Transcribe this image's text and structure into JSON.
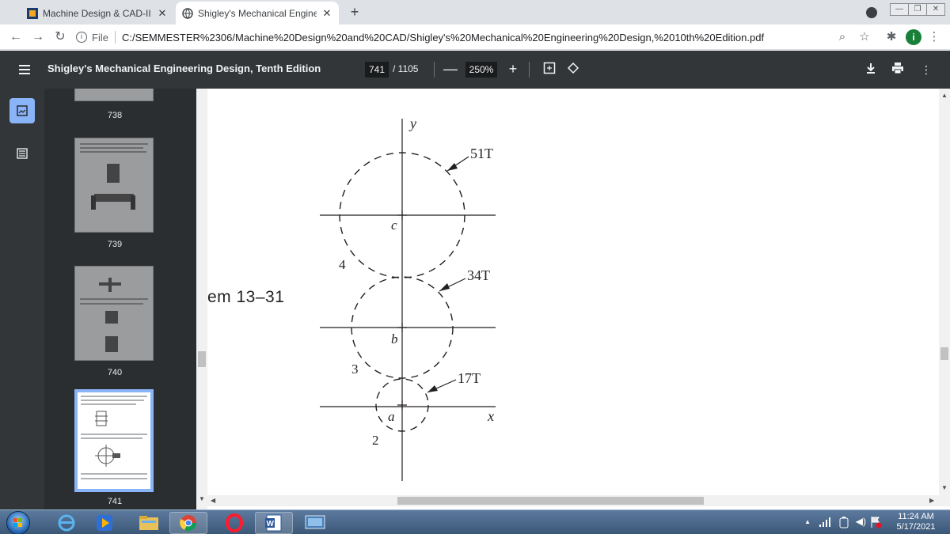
{
  "tabs": [
    {
      "title": "Machine Design & CAD-II (Engr.M",
      "close": "✕",
      "active": false
    },
    {
      "title": "Shigley's Mechanical Engineering",
      "close": "✕",
      "active": true
    }
  ],
  "new_tab": "+",
  "addressbar": {
    "scheme_label": "File",
    "url": "C:/SEMMESTER%2306/Machine%20Design%20and%20CAD/Shigley's%20Mechanical%20Engineering%20Design,%2010th%20Edition.pdf"
  },
  "profile_initial": "i",
  "pdf_toolbar": {
    "title": "Shigley's Mechanical Engineering Design, Tenth Edition",
    "current_page": "741",
    "total_pages": "/ 1105",
    "zoom": "250%",
    "zoom_out": "—",
    "zoom_in": "+"
  },
  "sidebar": {
    "thumbnails": [
      {
        "page": "738"
      },
      {
        "page": "739"
      },
      {
        "page": "740"
      },
      {
        "page": "741",
        "selected": true
      }
    ]
  },
  "document": {
    "problem_label": "em 13–31",
    "gears": [
      {
        "teeth": "51T",
        "center": "c",
        "shaft": "4"
      },
      {
        "teeth": "34T",
        "center": "b",
        "shaft": "3"
      },
      {
        "teeth": "17T",
        "center": "a",
        "shaft": "2"
      }
    ],
    "axis_x": "x",
    "axis_y": "y"
  },
  "taskbar": {
    "time": "11:24 AM",
    "date": "5/17/2021"
  },
  "colors": {
    "pdf_toolbar": "#323639",
    "sidebar": "#2b2e31",
    "accent": "#8ab4f8"
  }
}
